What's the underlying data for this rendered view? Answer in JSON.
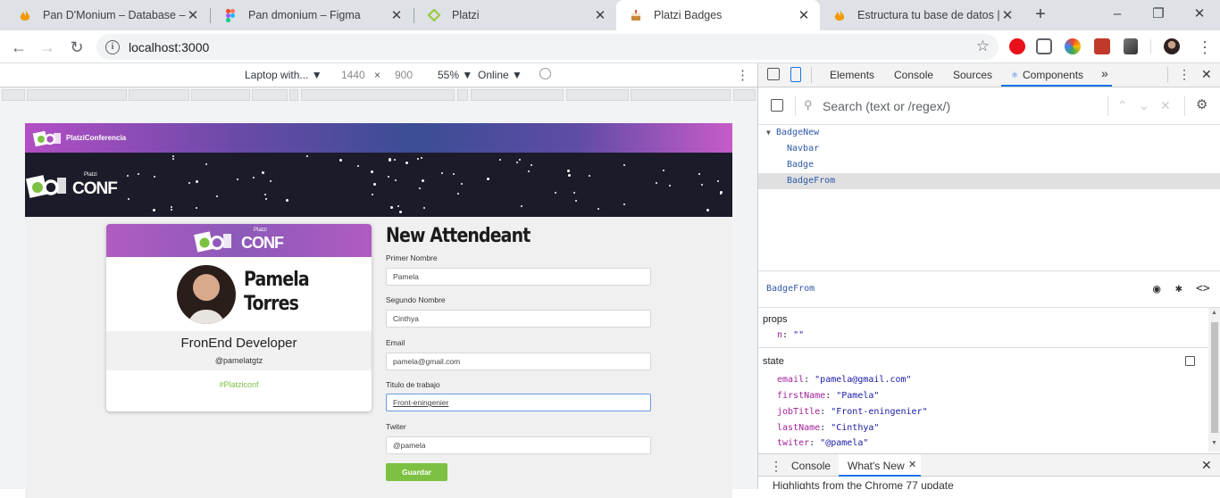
{
  "browser": {
    "tabs": [
      {
        "title": "Pan D'Monium – Database – Fi",
        "icon": "notion-flame-icon"
      },
      {
        "title": "Pan dmonium – Figma",
        "icon": "figma-icon"
      },
      {
        "title": "Platzi",
        "icon": "platzi-icon"
      },
      {
        "title": "Platzi Badges",
        "icon": "react-cake-icon",
        "active": true
      },
      {
        "title": "Estructura tu base de datos |",
        "icon": "notion-flame-icon"
      }
    ],
    "new_tab": "+",
    "window": {
      "minimize": "–",
      "restore": "❐",
      "close": "✕"
    },
    "url": "localhost:3000"
  },
  "device_toolbar": {
    "device": "Laptop with...",
    "width": "1440",
    "times": "×",
    "height": "900",
    "zoom": "55%",
    "network": "Online"
  },
  "page": {
    "topbar_logo_text": "PlatziConferencia",
    "hero_logo_small": "Platzi",
    "hero_logo": "CONF",
    "badge": {
      "logo_small": "Platzi",
      "logo": "CONF",
      "first_name": "Pamela",
      "last_name": "Torres",
      "job_title": "FronEnd Developer",
      "twitter": "@pamelatgtz",
      "hashtag": "#Platziconf"
    },
    "form": {
      "title": "New Attendeant",
      "fields": [
        {
          "label": "Primer Nombre",
          "value": "Pamela"
        },
        {
          "label": "Segundo Nombre",
          "value": "Cinthya"
        },
        {
          "label": "Email",
          "value": "pamela@gmail.com"
        },
        {
          "label": "Titulo de trabajo",
          "value": "Front-eningenier"
        },
        {
          "label": "Twiter",
          "value": "@pamela"
        }
      ],
      "submit": "Guardar"
    }
  },
  "devtools": {
    "tabs": [
      "Elements",
      "Console",
      "Sources",
      "Components"
    ],
    "active_tab": "Components",
    "more": "»",
    "search_placeholder": "Search (text or /regex/)",
    "tree": [
      {
        "label": "BadgeNew",
        "depth": 0,
        "expanded": true
      },
      {
        "label": "Navbar",
        "depth": 1
      },
      {
        "label": "Badge",
        "depth": 1
      },
      {
        "label": "BadgeFrom",
        "depth": 1,
        "selected": true
      }
    ],
    "selected_component": "BadgeFrom",
    "props_title": "props",
    "props": [
      {
        "key": "n",
        "value": "\"\""
      }
    ],
    "state_title": "state",
    "state": [
      {
        "key": "email",
        "value": "\"pamela@gmail.com\""
      },
      {
        "key": "firstName",
        "value": "\"Pamela\""
      },
      {
        "key": "jobTitle",
        "value": "\"Front-eningenier\""
      },
      {
        "key": "lastName",
        "value": "\"Cinthya\""
      },
      {
        "key": "twiter",
        "value": "\"@pamela\""
      }
    ],
    "drawer_tabs": [
      "Console",
      "What's New"
    ],
    "drawer_text": "Highlights from the Chrome 77 update"
  },
  "colors": {
    "accent_green": "#7dc142",
    "accent_purple": "#b24fc4",
    "devtools_blue": "#1a73e8"
  }
}
